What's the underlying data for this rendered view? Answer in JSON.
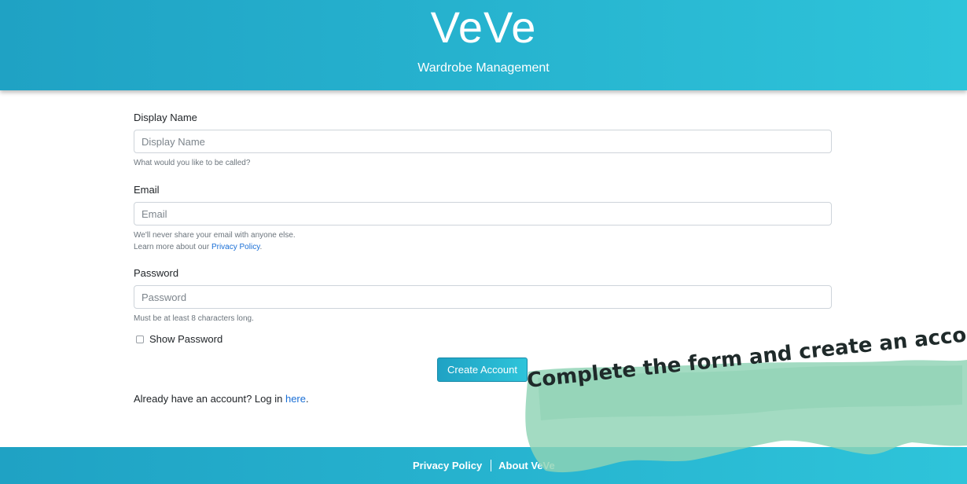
{
  "header": {
    "brand": "VeVe",
    "tagline": "Wardrobe Management"
  },
  "form": {
    "display_name": {
      "label": "Display Name",
      "placeholder": "Display Name",
      "help": "What would you like to be called?"
    },
    "email": {
      "label": "Email",
      "placeholder": "Email",
      "help_line1": "We'll never share your email with anyone else.",
      "help_line2_prefix": "Learn more about our ",
      "help_link": "Privacy Policy",
      "help_line2_suffix": "."
    },
    "password": {
      "label": "Password",
      "placeholder": "Password",
      "help": "Must be at least 8 characters long."
    },
    "show_password_label": "Show Password",
    "submit_label": "Create Account",
    "login_prefix": "Already have an account? Log in ",
    "login_link": "here",
    "login_suffix": "."
  },
  "footer": {
    "privacy_link": "Privacy Policy",
    "about_link": "About VeVe"
  },
  "callout": {
    "text": "Complete the form and create an account.",
    "color": "#8fd3b4"
  },
  "colors": {
    "accent_start": "#1fa2c4",
    "accent_end": "#2ec4da",
    "link": "#1a6fd6"
  }
}
